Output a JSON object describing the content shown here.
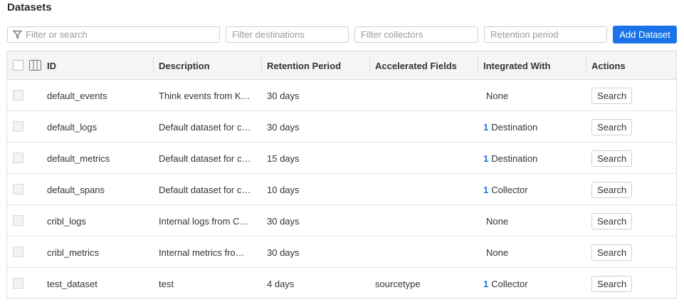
{
  "page": {
    "title": "Datasets"
  },
  "filters": {
    "search_placeholder": "Filter or search",
    "destinations_placeholder": "Filter destinations",
    "collectors_placeholder": "Filter collectors",
    "retention_placeholder": "Retention period"
  },
  "add_button_label": "Add Dataset",
  "table": {
    "headers": {
      "id": "ID",
      "description": "Description",
      "retention": "Retention Period",
      "accelerated": "Accelerated Fields",
      "integrated": "Integrated With",
      "actions": "Actions"
    },
    "rows": [
      {
        "id": "default_events",
        "description": "Think events from K…",
        "retention": "30 days",
        "accelerated": "",
        "integrated_count": "",
        "integrated_text": "None",
        "action": "Search"
      },
      {
        "id": "default_logs",
        "description": "Default dataset for c…",
        "retention": "30 days",
        "accelerated": "",
        "integrated_count": "1",
        "integrated_text": "Destination",
        "action": "Search"
      },
      {
        "id": "default_metrics",
        "description": "Default dataset for c…",
        "retention": "15 days",
        "accelerated": "",
        "integrated_count": "1",
        "integrated_text": "Destination",
        "action": "Search"
      },
      {
        "id": "default_spans",
        "description": "Default dataset for c…",
        "retention": "10 days",
        "accelerated": "",
        "integrated_count": "1",
        "integrated_text": "Collector",
        "action": "Search"
      },
      {
        "id": "cribl_logs",
        "description": "Internal logs from C…",
        "retention": "30 days",
        "accelerated": "",
        "integrated_count": "",
        "integrated_text": "None",
        "action": "Search"
      },
      {
        "id": "cribl_metrics",
        "description": "Internal metrics fro…",
        "retention": "30 days",
        "accelerated": "",
        "integrated_count": "",
        "integrated_text": "None",
        "action": "Search"
      },
      {
        "id": "test_dataset",
        "description": "test",
        "retention": "4 days",
        "accelerated": "sourcetype",
        "integrated_count": "1",
        "integrated_text": "Collector",
        "action": "Search"
      }
    ]
  },
  "colors": {
    "accent": "#1a73e8",
    "header_bg": "#f5f5f5",
    "border": "#dcdcdc"
  },
  "icons": {
    "filter": "funnel-icon",
    "columns": "columns-icon"
  }
}
